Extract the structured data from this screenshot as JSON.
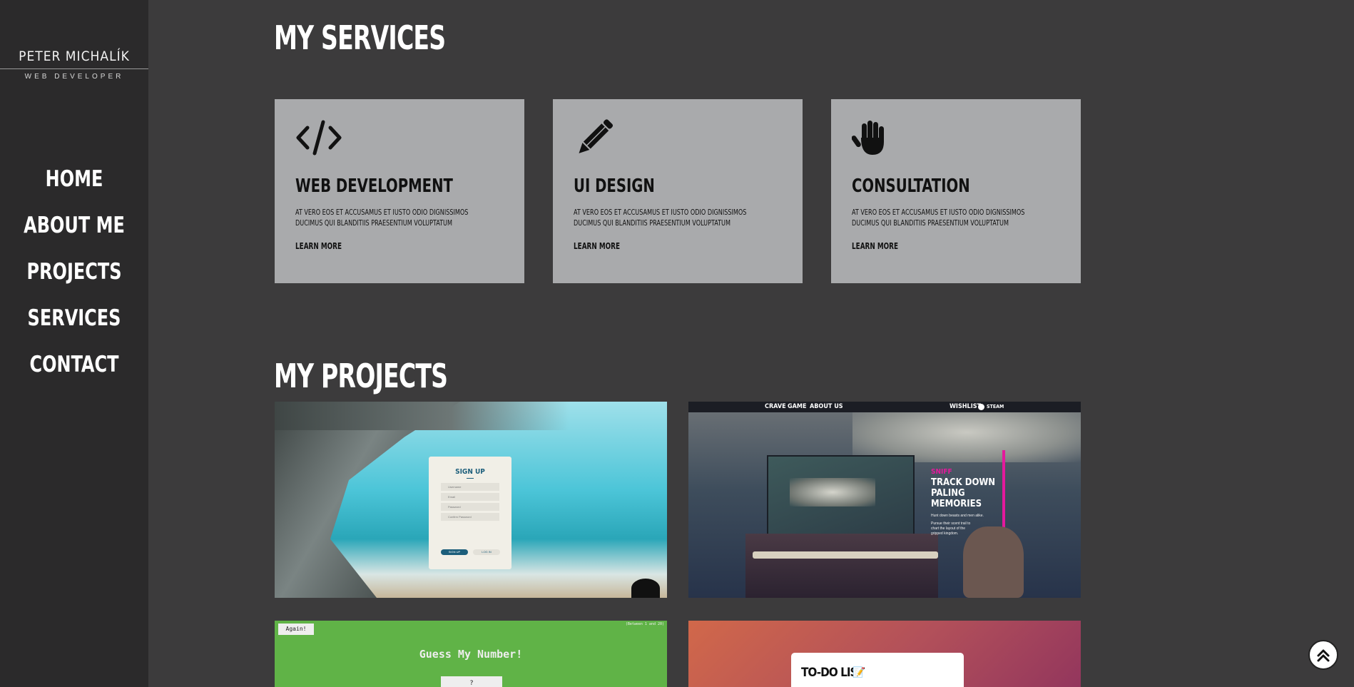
{
  "brand": {
    "name": "PETER MICHALÍK",
    "subtitle": "WEB DEVELOPER"
  },
  "nav": [
    "HOME",
    "ABOUT ME",
    "PROJECTS",
    "SERVICES",
    "CONTACT"
  ],
  "services": {
    "title": "MY SERVICES",
    "items": [
      {
        "icon": "code-icon",
        "title": "WEB DEVELOPMENT",
        "text": "AT VERO EOS ET ACCUSAMUS ET IUSTO ODIO DIGNISSIMOS DUCIMUS QUI BLANDITIIS PRAESENTIUM VOLUPTATUM",
        "link": "LEARN MORE"
      },
      {
        "icon": "pencil-icon",
        "title": "UI DESIGN",
        "text": "AT VERO EOS ET ACCUSAMUS ET IUSTO ODIO DIGNISSIMOS DUCIMUS QUI BLANDITIIS PRAESENTIUM VOLUPTATUM",
        "link": "LEARN MORE"
      },
      {
        "icon": "hand-icon",
        "title": "CONSULTATION",
        "text": "AT VERO EOS ET ACCUSAMUS ET IUSTO ODIO DIGNISSIMOS DUCIMUS QUI BLANDITIIS PRAESENTIUM VOLUPTATUM",
        "link": "LEARN MORE"
      }
    ]
  },
  "projects": {
    "title": "MY PROJECTS",
    "signup": {
      "heading": "SIGN UP",
      "fields": [
        "Username",
        "Email",
        "Password",
        "Confirm Password"
      ],
      "primary": "SIGN UP",
      "secondary": "LOG IN"
    },
    "game": {
      "nav": [
        "CRAVE",
        "GAME",
        "ABOUT US"
      ],
      "wishlist": "WISHLIST",
      "steam": "STEAM",
      "tag": "SNIFF",
      "headline": [
        "TRACK DOWN",
        "PALING",
        "MEMORIES"
      ],
      "body1": "Hunt down beasts and men alike.",
      "body2": "Pursue their scent trail to chart the layout of the gripped kingdom."
    },
    "guess": {
      "again": "Again!",
      "range": "(Between 1 and 20)",
      "title": "Guess My Number!",
      "box": "?"
    },
    "todo": {
      "title": "TO-DO LIST",
      "emoji": "📝"
    }
  },
  "colors": {
    "background": "#3c3b3c",
    "sidebar": "#2b2a2b",
    "card": "#a9aaac",
    "accent_pink": "#e4199c",
    "guess_green": "#60b347"
  }
}
